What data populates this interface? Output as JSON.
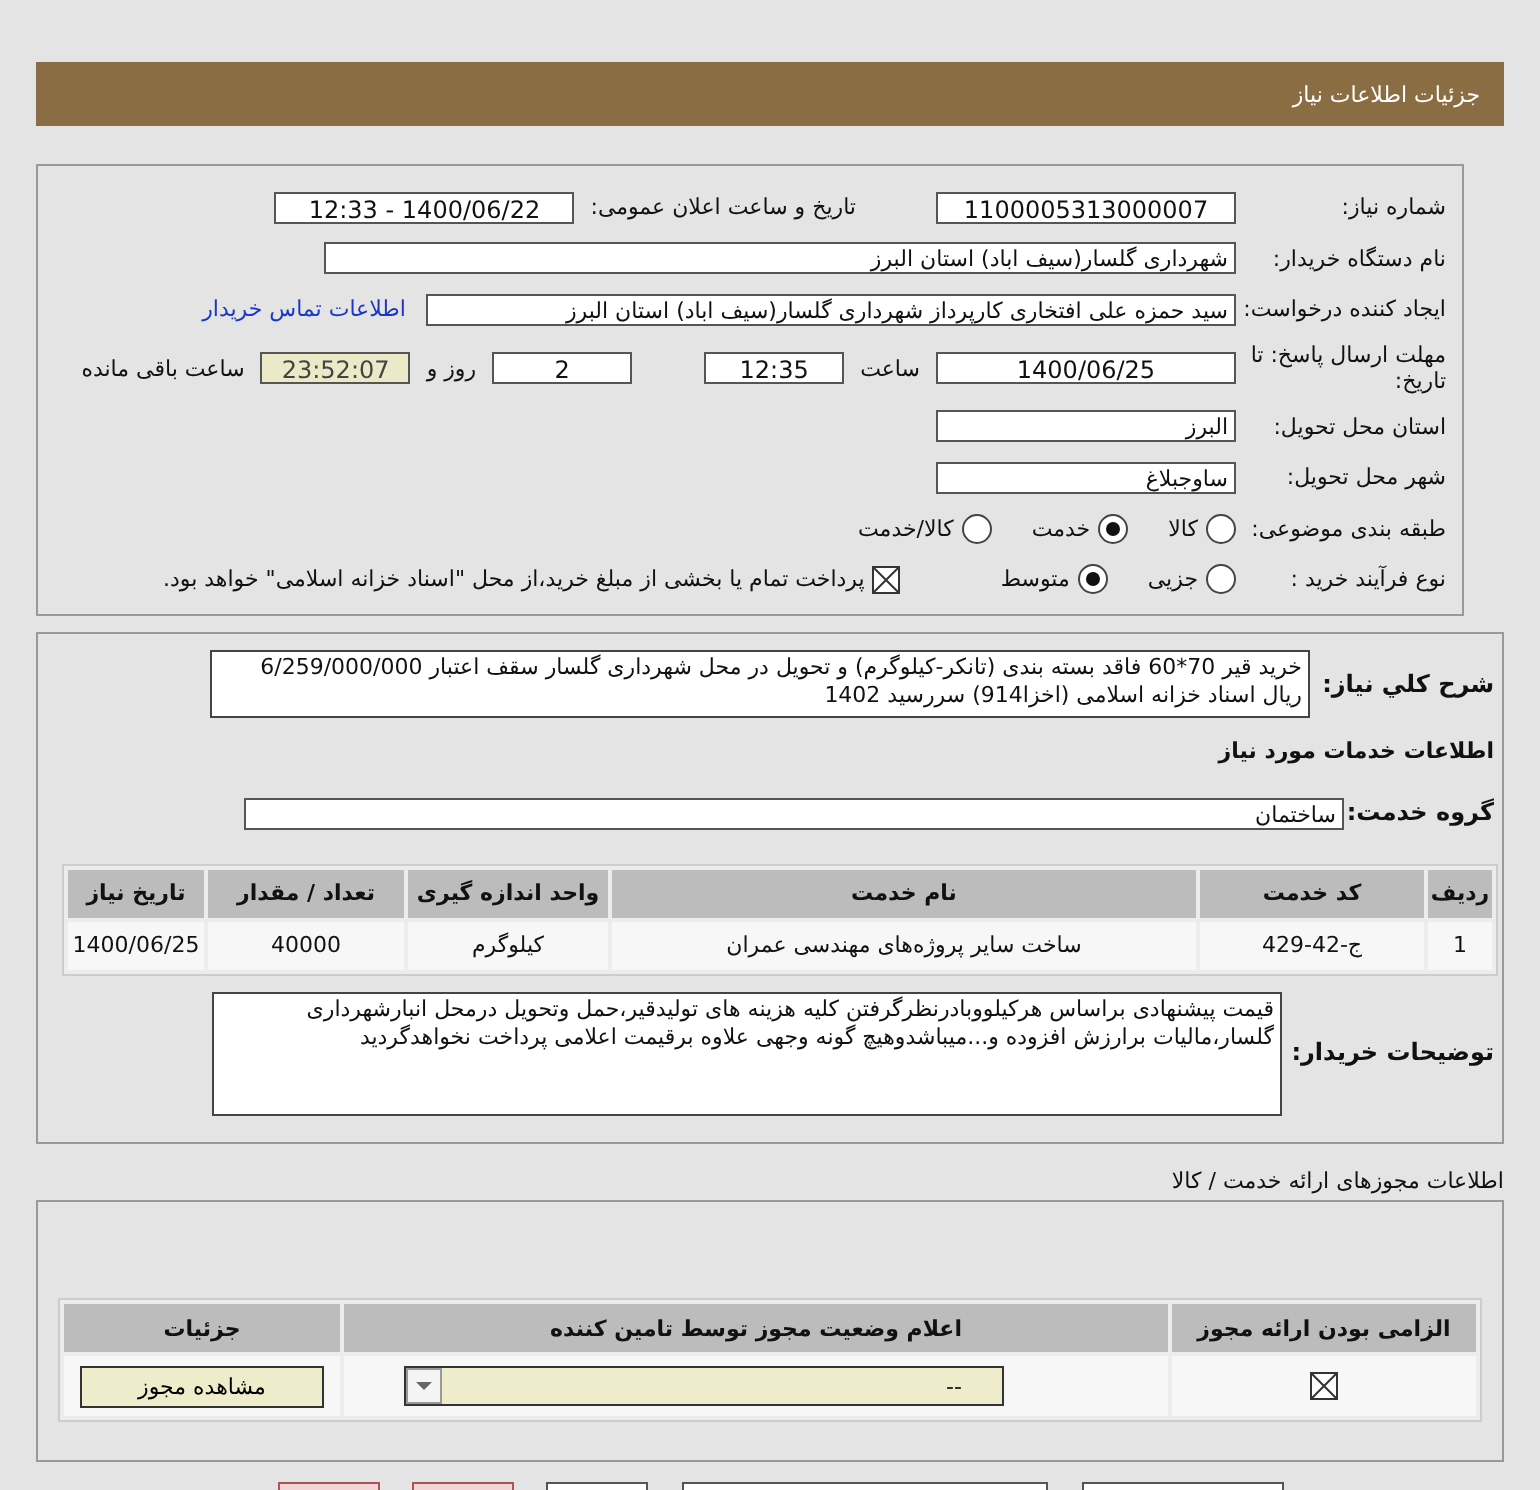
{
  "header": {
    "title": "جزئیات اطلاعات نیاز"
  },
  "details": {
    "need_number": {
      "label": "شماره نیاز:",
      "value": "1100005313000007"
    },
    "announce": {
      "label": "تاریخ و ساعت اعلان عمومی:",
      "value": "1400/06/22 - 12:33"
    },
    "buyer": {
      "label": "نام دستگاه خریدار:",
      "value": "شهرداری گلسار(سیف اباد) استان البرز"
    },
    "creator": {
      "label": "ایجاد کننده درخواست:",
      "value": "سید حمزه علی افتخاری کارپرداز شهرداری گلسار(سیف اباد) استان البرز",
      "link": "اطلاعات تماس خریدار"
    },
    "deadline": {
      "label": "مهلت ارسال پاسخ: تا تاریخ:",
      "date": "1400/06/25",
      "time_label": "ساعت",
      "time": "12:35",
      "days": "2",
      "days_label": "روز و",
      "remaining": "23:52:07",
      "remaining_label": "ساعت باقی مانده"
    },
    "province": {
      "label": "استان محل تحویل:",
      "value": "البرز"
    },
    "city": {
      "label": "شهر محل تحویل:",
      "value": "ساوجبلاغ"
    },
    "category": {
      "label": "طبقه بندی موضوعی:",
      "options": [
        {
          "label": "کالا",
          "selected": false
        },
        {
          "label": "خدمت",
          "selected": true
        },
        {
          "label": "کالا/خدمت",
          "selected": false
        }
      ]
    },
    "process": {
      "label": "نوع فرآیند خرید :",
      "options": [
        {
          "label": "جزیی",
          "selected": false
        },
        {
          "label": "متوسط",
          "selected": true
        }
      ],
      "treasury": {
        "label": "پرداخت تمام یا بخشی از مبلغ خرید،از محل \"اسناد خزانه اسلامی\" خواهد بود.",
        "checked": true
      }
    }
  },
  "summary": {
    "label": "شرح کلي نياز:",
    "text": "خرید قیر 70*60 فاقد بسته بندی (تانکر-کیلوگرم) و تحویل در محل شهرداری گلسار سقف اعتبار 6/259/000/000 ریال اسناد خزانه اسلامی (اخزا914) سررسید 1402"
  },
  "services": {
    "title": "اطلاعات خدمات مورد نیاز",
    "group_label": "گروه خدمت:",
    "group": "ساختمان",
    "table": {
      "columns": [
        "ردیف",
        "کد خدمت",
        "نام خدمت",
        "واحد اندازه گیری",
        "تعداد / مقدار",
        "تاریخ نیاز"
      ],
      "rows": [
        [
          "1",
          "ج-42-429",
          "ساخت سایر پروژه‌های مهندسی عمران",
          "کیلوگرم",
          "40000",
          "1400/06/25"
        ]
      ]
    },
    "notes_label": "توضیحات خریدار:",
    "notes": "قیمت پیشنهادی براساس هرکیلووبادرنظرگرفتن کلیه هزینه های تولیدقیر،حمل وتحویل درمحل انبارشهرداری گلسار،مالیات برارزش افزوده و...میباشدوهیچ گونه وجهی علاوه برقیمت اعلامی پرداخت نخواهدگردید"
  },
  "permits": {
    "title": "اطلاعات مجوزهای ارائه خدمت / کالا",
    "columns": [
      "الزامی بودن ارائه مجوز",
      "اعلام وضعیت مجوز توسط تامین کننده",
      "جزئیات"
    ],
    "rows": [
      {
        "required": true,
        "status": "--",
        "button": "مشاهده مجوز"
      }
    ]
  },
  "bottom_buttons": [
    {
      "kind": "plain"
    },
    {
      "kind": "plain"
    },
    {
      "kind": "plain"
    },
    {
      "kind": "danger"
    },
    {
      "kind": "danger"
    }
  ]
}
